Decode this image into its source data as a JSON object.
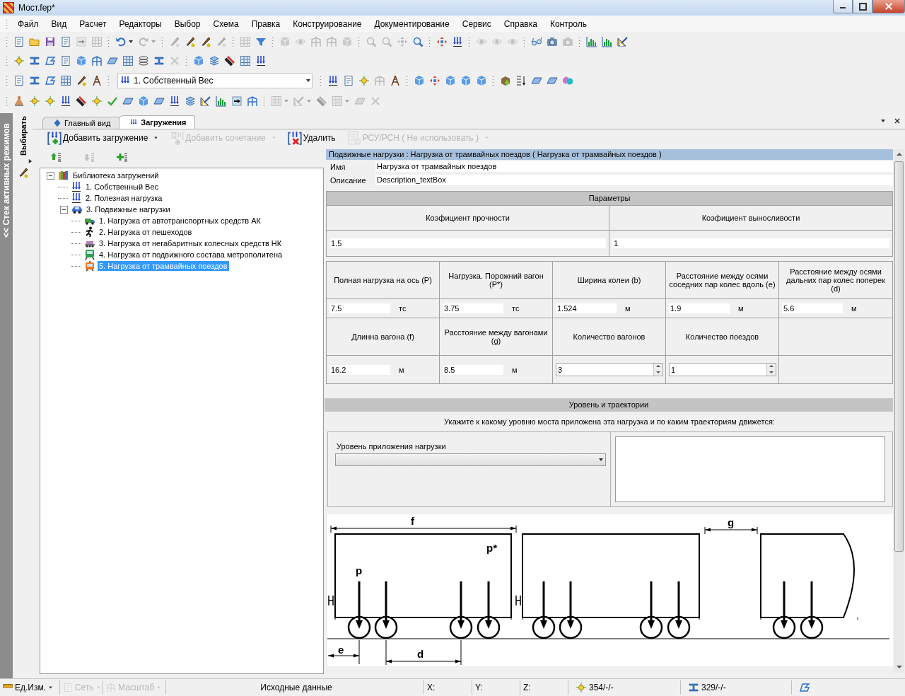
{
  "window": {
    "title": "Мост.fep*"
  },
  "menu": [
    "Файл",
    "Вид",
    "Расчет",
    "Редакторы",
    "Выбор",
    "Схема",
    "Правка",
    "Конструирование",
    "Документирование",
    "Сервис",
    "Справка",
    "Контроль"
  ],
  "toolbars": [
    [
      [
        {
          "kind": "doc",
          "disabled": false
        },
        {
          "kind": "folder",
          "disabled": false
        },
        {
          "kind": "save",
          "disabled": false
        },
        {
          "kind": "doc",
          "disabled": false
        },
        {
          "kind": "arrow",
          "disabled": true
        },
        {
          "kind": "grid",
          "disabled": true
        }
      ],
      [
        {
          "kind": "undo",
          "disabled": false,
          "dropdown": true
        },
        {
          "kind": "redo",
          "disabled": true,
          "dropdown": true
        }
      ],
      [
        {
          "kind": "pen",
          "disabled": true
        },
        {
          "kind": "pen",
          "disabled": false
        },
        {
          "kind": "pen",
          "disabled": false
        },
        {
          "kind": "pen",
          "disabled": true
        }
      ],
      [
        {
          "kind": "grid",
          "disabled": true
        },
        {
          "kind": "filter",
          "disabled": false
        }
      ],
      [
        {
          "kind": "cube",
          "disabled": true
        },
        {
          "kind": "eye",
          "disabled": true
        },
        {
          "kind": "frame",
          "disabled": true
        },
        {
          "kind": "frame",
          "disabled": true
        },
        {
          "kind": "cube",
          "disabled": true
        }
      ],
      [
        {
          "kind": "zoom",
          "disabled": true
        },
        {
          "kind": "zoom",
          "disabled": true
        },
        {
          "kind": "move",
          "disabled": true
        },
        {
          "kind": "zoom",
          "disabled": false
        }
      ],
      [
        {
          "kind": "move",
          "disabled": false
        },
        {
          "kind": "load",
          "disabled": false
        }
      ],
      [
        {
          "kind": "eye",
          "disabled": true
        },
        {
          "kind": "eye",
          "disabled": true
        },
        {
          "kind": "eye",
          "disabled": true
        }
      ],
      [
        {
          "kind": "glasses",
          "disabled": false
        },
        {
          "kind": "camera",
          "disabled": false
        },
        {
          "kind": "camera",
          "disabled": true
        }
      ],
      [
        {
          "kind": "chart",
          "disabled": false
        },
        {
          "kind": "chart",
          "disabled": false
        },
        {
          "kind": "ruler",
          "disabled": false
        }
      ]
    ],
    [
      [
        {
          "kind": "node",
          "disabled": false
        },
        {
          "kind": "beam",
          "disabled": false
        },
        {
          "kind": "shape",
          "disabled": false
        },
        {
          "kind": "doc",
          "disabled": false
        },
        {
          "kind": "cube",
          "disabled": false
        },
        {
          "kind": "frame",
          "disabled": false
        },
        {
          "kind": "plate",
          "disabled": false
        },
        {
          "kind": "grid",
          "disabled": false
        },
        {
          "kind": "spring",
          "disabled": false
        },
        {
          "kind": "beam",
          "disabled": false
        },
        {
          "kind": "delete",
          "disabled": true
        }
      ],
      [
        {
          "kind": "cube",
          "disabled": false
        },
        {
          "kind": "stack",
          "disabled": false
        },
        {
          "kind": "bar",
          "disabled": false
        },
        {
          "kind": "grid",
          "disabled": false
        },
        {
          "kind": "load",
          "disabled": false
        }
      ]
    ],
    [
      [
        {
          "kind": "doc",
          "disabled": false
        },
        {
          "kind": "beam",
          "disabled": false
        },
        {
          "kind": "shape",
          "disabled": false
        },
        {
          "kind": "grid",
          "disabled": false
        },
        {
          "kind": "pen",
          "disabled": false
        },
        {
          "kind": "tower",
          "disabled": false
        }
      ],
      [
        {
          "kind": "combo",
          "value": "1. Собственный Вес"
        }
      ],
      [
        {
          "kind": "load",
          "disabled": false
        },
        {
          "kind": "doc",
          "disabled": false
        },
        {
          "kind": "node",
          "disabled": false
        },
        {
          "kind": "frame",
          "disabled": true
        },
        {
          "kind": "tower",
          "disabled": false
        }
      ],
      [
        {
          "kind": "cube",
          "disabled": false
        },
        {
          "kind": "move",
          "disabled": false
        },
        {
          "kind": "cube",
          "disabled": false
        },
        {
          "kind": "cube",
          "disabled": false
        },
        {
          "kind": "cube",
          "disabled": false
        }
      ],
      [
        {
          "kind": "box",
          "disabled": false
        },
        {
          "kind": "sort",
          "disabled": false
        },
        {
          "kind": "plate",
          "disabled": false
        },
        {
          "kind": "plate",
          "disabled": false
        },
        {
          "kind": "shapes",
          "disabled": false
        }
      ]
    ],
    [
      [
        {
          "kind": "cone",
          "disabled": false
        },
        {
          "kind": "node",
          "disabled": false
        },
        {
          "kind": "node",
          "disabled": false
        },
        {
          "kind": "load",
          "disabled": false
        },
        {
          "kind": "bar",
          "disabled": false
        },
        {
          "kind": "node",
          "disabled": false
        },
        {
          "kind": "check",
          "disabled": false
        },
        {
          "kind": "plate",
          "disabled": false
        },
        {
          "kind": "cube",
          "disabled": false
        },
        {
          "kind": "plate",
          "disabled": false
        },
        {
          "kind": "load",
          "disabled": false
        },
        {
          "kind": "stack",
          "disabled": false
        },
        {
          "kind": "ruler",
          "disabled": false
        },
        {
          "kind": "chart",
          "disabled": false
        },
        {
          "kind": "arrow",
          "disabled": false
        },
        {
          "kind": "frame",
          "disabled": false
        }
      ],
      [
        {
          "kind": "grid",
          "disabled": true,
          "dropdown": true
        },
        {
          "kind": "ruler",
          "disabled": true,
          "dropdown": true
        },
        {
          "kind": "bar",
          "disabled": true
        },
        {
          "kind": "grid",
          "disabled": true,
          "dropdown": true
        },
        {
          "kind": "plate",
          "disabled": true
        },
        {
          "kind": "delete",
          "disabled": true
        }
      ]
    ]
  ],
  "side_strip": {
    "label": "<< Стек активных режимов"
  },
  "mode_panel": {
    "label": "Выбирать"
  },
  "tabs": [
    {
      "kind": "view",
      "label": "Главный вид",
      "selected": false
    },
    {
      "kind": "loads",
      "label": "Загружения",
      "selected": true
    }
  ],
  "actions": [
    {
      "kind": "add",
      "label": "Добавить загружение",
      "dropdown": true,
      "disabled": false
    },
    {
      "kind": "sum",
      "label": "Добавить сочетание",
      "dropdown": true,
      "disabled": true
    },
    {
      "kind": "delete",
      "label": "Удалить",
      "dropdown": false,
      "disabled": false
    },
    {
      "kind": "combination",
      "label": "РСУ/РСН ( Не использовать )",
      "dropdown": true,
      "disabled": true
    }
  ],
  "tree_tools": [
    {
      "kind": "up",
      "disabled": false
    },
    {
      "kind": "down",
      "disabled": true
    },
    {
      "kind": "add",
      "disabled": false
    }
  ],
  "tree": [
    {
      "kind": "library",
      "label": "Библиотека загружений",
      "expanded": true,
      "selected": false,
      "children": [
        {
          "kind": "load",
          "label": "1. Собственный Вес",
          "selected": false
        },
        {
          "kind": "load",
          "label": "2. Полезная нагрузка",
          "selected": false
        },
        {
          "kind": "car",
          "label": "3. Подвижные нагрузки",
          "expanded": true,
          "selected": false,
          "children": [
            {
              "kind": "truck",
              "label": "1. Нагрузка от автотранспортных средств АК",
              "selected": false
            },
            {
              "kind": "pedestrian",
              "label": "2. Нагрузка от пешеходов",
              "selected": false
            },
            {
              "kind": "oversize",
              "label": "3. Нагрузка от негабаритных колесных средств НК",
              "selected": false
            },
            {
              "kind": "metro",
              "label": "4. Нагрузка от подвижного состава метрополитена",
              "selected": false
            },
            {
              "kind": "tram",
              "label": "5. Нагрузка от трамвайных поездов",
              "selected": true
            }
          ]
        }
      ]
    }
  ],
  "details": {
    "header": "Подвижные нагрузки : Нагрузка от трамвайных поездов ( Нагрузка от трамвайных поездов )",
    "name_label": "Имя",
    "name": "Нагрузка от трамвайных поездов",
    "description_label": "Описание",
    "description": "Description_textBox",
    "parameters": {
      "title": "Параметры",
      "coefficients": [
        {
          "label": "Коэфициент прочности",
          "value": "1.5"
        },
        {
          "label": "Коэфициент выносливости",
          "value": "1"
        }
      ],
      "fields": [
        {
          "kind": "text",
          "label": "Полная нагрузка на ось (P)",
          "value": "7.5",
          "unit": "тс"
        },
        {
          "kind": "text",
          "label": "Нагрузка. Порожний вагон (P*)",
          "value": "3.75",
          "unit": "тс"
        },
        {
          "kind": "text",
          "label": "Ширина колеи (b)",
          "value": "1.524",
          "unit": "м"
        },
        {
          "kind": "text",
          "label": "Расстояние между осями соседних пар колес вдоль (e)",
          "value": "1.9",
          "unit": "м"
        },
        {
          "kind": "text",
          "label": "Расстояние между осями дальних пар колес поперек (d)",
          "value": "5.6",
          "unit": "м"
        },
        {
          "kind": "text",
          "label": "Длинна вагона (f)",
          "value": "16.2",
          "unit": "м"
        },
        {
          "kind": "text",
          "label": "Расстояние между вагонами (g)",
          "value": "8.5",
          "unit": "м"
        },
        {
          "kind": "spin",
          "label": "Количество вагонов",
          "value": "3"
        },
        {
          "kind": "spin",
          "label": "Количество поездов",
          "value": "1"
        }
      ]
    },
    "level": {
      "title": "Уровень и траектории",
      "hint": "Укажите к какому уровню моста приложена эта нагрузка и по каким траекториям движется:",
      "level_label": "Уровень приложения нагрузки"
    },
    "diagram": {
      "labels": [
        {
          "kind": "length",
          "text": "f"
        },
        {
          "kind": "gap",
          "text": "g"
        },
        {
          "kind": "full_load",
          "text": "p"
        },
        {
          "kind": "empty_load",
          "text": "p*"
        },
        {
          "kind": "axle_spacing",
          "text": "e"
        },
        {
          "kind": "bogie_spacing",
          "text": "d"
        }
      ]
    }
  },
  "status_bar": [
    {
      "kind": "menu",
      "label": "Ед.Изм.",
      "disabled": false
    },
    {
      "kind": "menu",
      "label": "Сеть",
      "disabled": true
    },
    {
      "kind": "menu",
      "label": "Масштаб",
      "disabled": true
    },
    {
      "kind": "text",
      "label": "Исходные данные"
    },
    {
      "kind": "text",
      "label": "X:"
    },
    {
      "kind": "text",
      "label": "Y:"
    },
    {
      "kind": "text",
      "label": "Z:"
    },
    {
      "kind": "counter",
      "label": "354/-/-"
    },
    {
      "kind": "counter",
      "label": "329/-/-"
    },
    {
      "kind": "icon"
    }
  ]
}
